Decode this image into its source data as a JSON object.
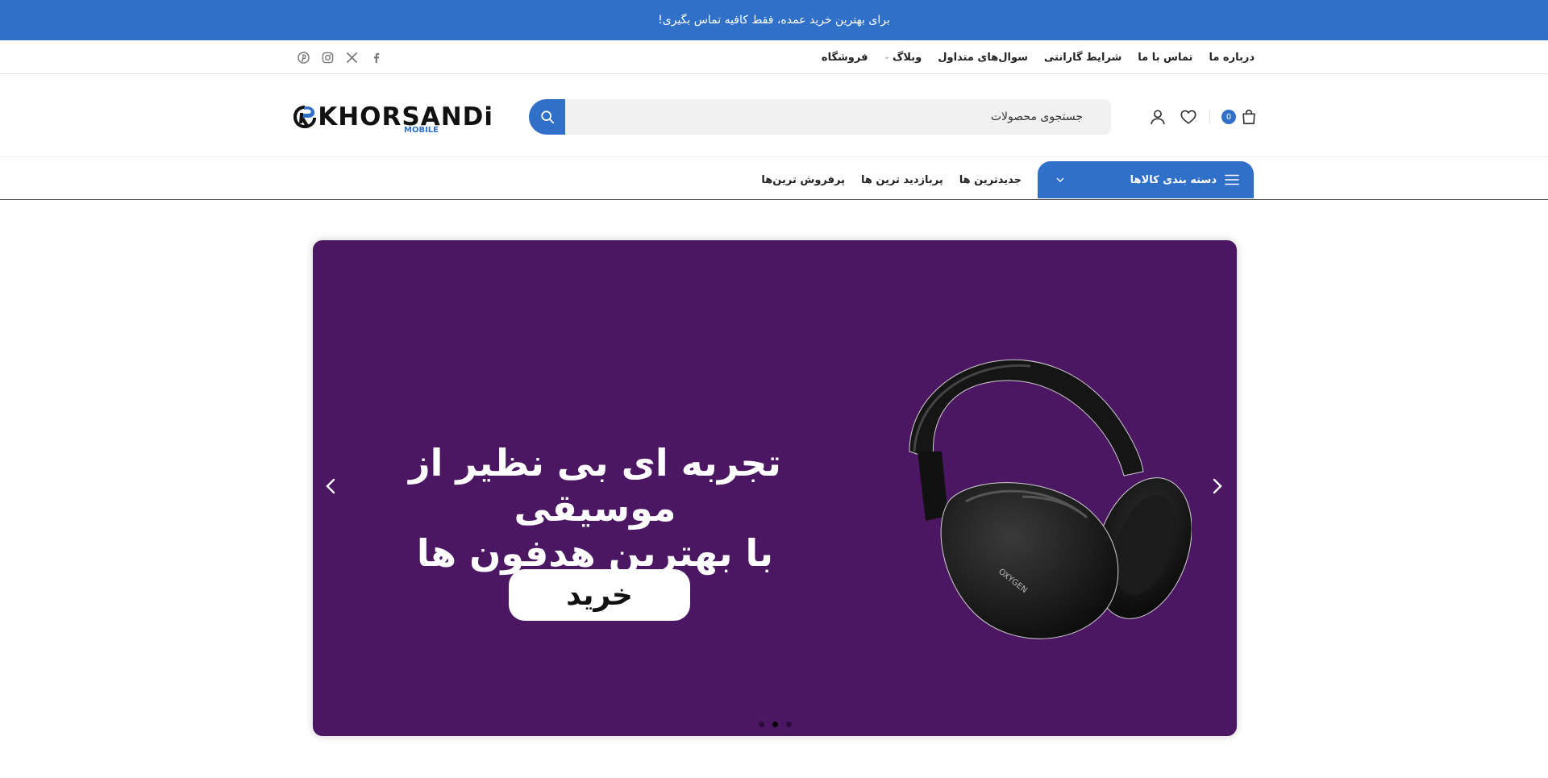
{
  "topbar": {
    "text": "برای بهترین خرید عمده، فقط کافیه تماس بگیری!"
  },
  "header_links": [
    {
      "label": "فروشگاه"
    },
    {
      "label": "وبلاگ",
      "has_dropdown": true
    },
    {
      "label": "سوال‌های متداول"
    },
    {
      "label": "شرایط گارانتی"
    },
    {
      "label": "تماس با ما"
    },
    {
      "label": "درباره ما"
    }
  ],
  "social": [
    "facebook-icon",
    "x-icon",
    "instagram-icon",
    "pinterest-icon"
  ],
  "logo": {
    "wordmark": "KHORSANDi",
    "sub": "MOBILE"
  },
  "search": {
    "placeholder": "جستجوی محصولات"
  },
  "cart": {
    "count": "0"
  },
  "category_button": {
    "label": "دسته بندی کالاها"
  },
  "nav_links": [
    {
      "label": "پرفروش ترین‌ها"
    },
    {
      "label": "پربازدید ترین ها"
    },
    {
      "label": "جدیدترین ها"
    }
  ],
  "slide": {
    "headline_line1": "تجربه ای بی نظیر از موسیقی",
    "headline_line2": "با بهترین هدفون ها",
    "cta": "خرید",
    "product_label": "OXYGEN"
  },
  "slider": {
    "dots": 3,
    "active": 1
  },
  "colors": {
    "brand_blue": "#3170c9",
    "slide_bg": "#4b1763"
  }
}
